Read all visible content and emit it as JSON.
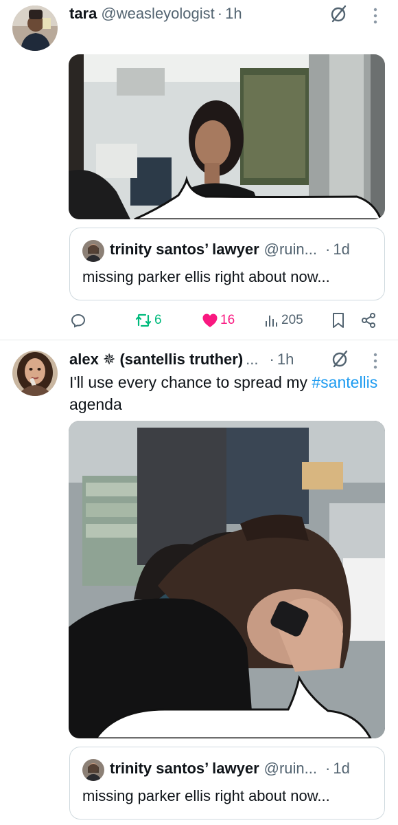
{
  "tweets": [
    {
      "author_name": "tara",
      "handle": "@weasleyologist",
      "separator": "·",
      "time": "1h",
      "text": "",
      "quote": {
        "author_name": "trinity santos’ lawyer",
        "handle": "@ruin...",
        "separator": "·",
        "time": "1d",
        "text": "missing parker ellis right about now..."
      },
      "actions": {
        "retweets": "6",
        "likes": "16",
        "views": "205"
      }
    },
    {
      "author_name": "alex ✵ (santellis truther)",
      "name_ellipsis": "...",
      "separator": "·",
      "time": "1h",
      "text_before": "I'll use every chance to spread my ",
      "hashtag": "#santellis",
      "text_after": " agenda",
      "quote": {
        "author_name": "trinity santos’ lawyer",
        "handle": "@ruin...",
        "separator": "·",
        "time": "1d",
        "text": "missing parker ellis right about now..."
      }
    }
  ],
  "colors": {
    "retweet_active": "#00ba7c",
    "like_active": "#f91880",
    "hashtag": "#1d9bf0",
    "secondary_text": "#536471"
  },
  "icons": [
    "reply-icon",
    "retweet-icon",
    "heart-icon",
    "views-icon",
    "bookmark-icon",
    "share-icon",
    "more-icon",
    "grok-icon"
  ]
}
